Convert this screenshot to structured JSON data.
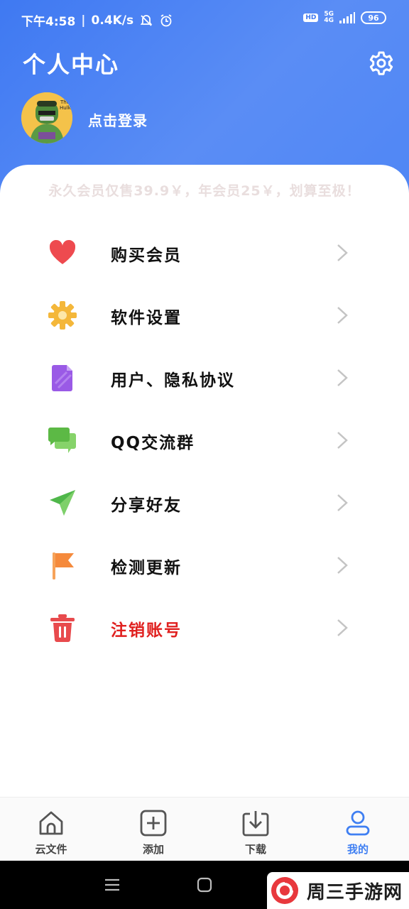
{
  "status_bar": {
    "time": "下午4:58",
    "speed": "0.4K/s",
    "hd": "HD",
    "network": "5G",
    "network_sub": "4G",
    "battery": "96"
  },
  "header": {
    "title": "个人中心",
    "login_text": "点击登录"
  },
  "promo_text": "永久会员仅售39.9￥，年会员25￥，划算至极！",
  "menu": [
    {
      "label": "购买会员",
      "icon": "heart-icon"
    },
    {
      "label": "软件设置",
      "icon": "gear-icon"
    },
    {
      "label": "用户、隐私协议",
      "icon": "document-icon"
    },
    {
      "label": "QQ交流群",
      "icon": "chat-icon"
    },
    {
      "label": "分享好友",
      "icon": "paper-plane-icon"
    },
    {
      "label": "检测更新",
      "icon": "flag-icon"
    },
    {
      "label": "注销账号",
      "icon": "trash-icon"
    }
  ],
  "tabs": [
    {
      "label": "云文件",
      "icon": "home-icon"
    },
    {
      "label": "添加",
      "icon": "add-icon"
    },
    {
      "label": "下载",
      "icon": "download-icon"
    },
    {
      "label": "我的",
      "icon": "user-icon"
    }
  ],
  "watermark": "周三手游网",
  "colors": {
    "header_blue": "#4a83f4",
    "danger_red": "#e0201f",
    "active_tab": "#3f7ff2"
  }
}
